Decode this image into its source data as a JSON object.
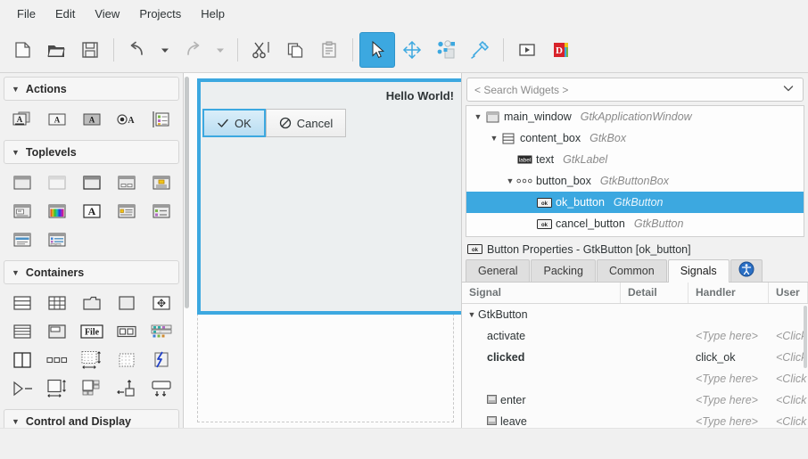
{
  "menubar": {
    "items": [
      {
        "label": "File"
      },
      {
        "label": "Edit"
      },
      {
        "label": "View"
      },
      {
        "label": "Projects"
      },
      {
        "label": "Help"
      }
    ]
  },
  "toolbar": {
    "buttons": [
      {
        "name": "new-icon",
        "label": "New"
      },
      {
        "name": "open-icon",
        "label": "Open"
      },
      {
        "name": "save-icon",
        "label": "Save"
      },
      {
        "name": "undo-icon",
        "label": "Undo"
      },
      {
        "name": "undo-dropdown-icon",
        "label": "Undo history"
      },
      {
        "name": "redo-icon",
        "label": "Redo"
      },
      {
        "name": "redo-dropdown-icon",
        "label": "Redo history"
      },
      {
        "name": "cut-icon",
        "label": "Cut"
      },
      {
        "name": "copy-icon",
        "label": "Copy"
      },
      {
        "name": "paste-icon",
        "label": "Paste"
      },
      {
        "name": "pointer-mode-icon",
        "label": "Select"
      },
      {
        "name": "drag-resize-mode-icon",
        "label": "Drag and Resize"
      },
      {
        "name": "margin-edit-mode-icon",
        "label": "Edit margins"
      },
      {
        "name": "align-edit-mode-icon",
        "label": "Edit alignment"
      },
      {
        "name": "preview-icon",
        "label": "Preview"
      },
      {
        "name": "glade-docs-icon",
        "label": "Glade"
      }
    ]
  },
  "palette": {
    "groups": [
      {
        "title": "Actions",
        "expanded": true,
        "items": [
          {
            "name": "gtk-action-icon",
            "label": "Action"
          },
          {
            "name": "gtk-toggle-action-icon",
            "label": "Toggle Action"
          },
          {
            "name": "gtk-recent-action-icon",
            "label": "Recent Action"
          },
          {
            "name": "gtk-radio-action-icon",
            "label": "Radio Action"
          },
          {
            "name": "gtk-action-group-icon",
            "label": "Action Group"
          }
        ]
      },
      {
        "title": "Toplevels",
        "expanded": true,
        "items": [
          {
            "name": "gtk-window-icon",
            "label": "Window"
          },
          {
            "name": "gtk-offscreen-window-icon",
            "label": "Offscreen Window"
          },
          {
            "name": "gtk-application-window-icon",
            "label": "Application Window"
          },
          {
            "name": "gtk-dialog-icon",
            "label": "Dialog"
          },
          {
            "name": "gtk-message-dialog-icon",
            "label": "Message Dialog"
          },
          {
            "name": "gtk-about-dialog-icon",
            "label": "About Dialog"
          },
          {
            "name": "gtk-color-chooser-dialog-icon",
            "label": "Color Chooser Dialog"
          },
          {
            "name": "gtk-font-chooser-dialog-icon",
            "label": "Font Chooser Dialog"
          },
          {
            "name": "gtk-file-chooser-dialog-icon",
            "label": "File Chooser Dialog"
          },
          {
            "name": "gtk-app-chooser-dialog-icon",
            "label": "Application Chooser Dialog"
          },
          {
            "name": "gtk-assistant-icon",
            "label": "Assistant"
          },
          {
            "name": "gtk-recent-chooser-dialog-icon",
            "label": "Recent Chooser Dialog"
          }
        ]
      },
      {
        "title": "Containers",
        "expanded": true,
        "items": [
          {
            "name": "gtk-box-icon",
            "label": "Box"
          },
          {
            "name": "gtk-grid-icon",
            "label": "Grid"
          },
          {
            "name": "gtk-notebook-icon",
            "label": "Notebook"
          },
          {
            "name": "gtk-frame-icon",
            "label": "Frame"
          },
          {
            "name": "gtk-scrolled-window-icon",
            "label": "Scrolled Window"
          },
          {
            "name": "gtk-list-box-icon",
            "label": "List Box"
          },
          {
            "name": "gtk-expander-icon",
            "label": "Expander"
          },
          {
            "name": "gtk-file-chooser-widget-icon",
            "label": "File Chooser Widget"
          },
          {
            "name": "gtk-stack-icon",
            "label": "Stack"
          },
          {
            "name": "gtk-headerbar-icon",
            "label": "Header Bar"
          },
          {
            "name": "gtk-paned-icon",
            "label": "Paned"
          },
          {
            "name": "gtk-button-box-icon",
            "label": "Button Box"
          },
          {
            "name": "gtk-fixed-icon",
            "label": "Fixed"
          },
          {
            "name": "gtk-layout-icon",
            "label": "Layout"
          },
          {
            "name": "gtk-event-box-icon",
            "label": "Event Box"
          },
          {
            "name": "gtk-overlay-icon",
            "label": "Overlay"
          },
          {
            "name": "gtk-aspect-frame-icon",
            "label": "Aspect Frame"
          },
          {
            "name": "gtk-flow-box-icon",
            "label": "Flow Box"
          },
          {
            "name": "gtk-revealer-icon",
            "label": "Revealer"
          },
          {
            "name": "gtk-popover-icon",
            "label": "Popover"
          }
        ]
      },
      {
        "title": "Control and Display",
        "expanded": true,
        "items": []
      }
    ]
  },
  "canvas": {
    "window_label": "Hello World!",
    "buttons": [
      {
        "name": "ok",
        "label": "OK",
        "icon": "check-icon",
        "selected": true
      },
      {
        "name": "cancel",
        "label": "Cancel",
        "icon": "forbidden-icon",
        "selected": false
      }
    ]
  },
  "search": {
    "placeholder": "< Search Widgets >",
    "value": ""
  },
  "widget_tree": {
    "rows": [
      {
        "indent": 0,
        "expander": "down",
        "icon": "gtk-window-icon",
        "name": "main_window",
        "type": "GtkApplicationWindow",
        "selected": false
      },
      {
        "indent": 1,
        "expander": "down",
        "icon": "gtk-box-icon",
        "name": "content_box",
        "type": "GtkBox",
        "selected": false
      },
      {
        "indent": 2,
        "expander": "none",
        "icon": "gtk-label-icon",
        "name": "text",
        "type": "GtkLabel",
        "selected": false
      },
      {
        "indent": 2,
        "expander": "down",
        "icon": "gtk-button-box-icon",
        "name": "button_box",
        "type": "GtkButtonBox",
        "selected": false
      },
      {
        "indent": 3,
        "expander": "none",
        "icon": "gtk-button-icon",
        "name": "ok_button",
        "type": "GtkButton",
        "selected": true
      },
      {
        "indent": 3,
        "expander": "none",
        "icon": "gtk-button-icon",
        "name": "cancel_button",
        "type": "GtkButton",
        "selected": false
      }
    ]
  },
  "properties": {
    "title": "Button Properties - GtkButton [ok_button]",
    "title_icon": "gtk-button-icon",
    "tabs": [
      {
        "label": "General",
        "active": false
      },
      {
        "label": "Packing",
        "active": false
      },
      {
        "label": "Common",
        "active": false
      },
      {
        "label": "Signals",
        "active": true
      },
      {
        "label": "",
        "active": false,
        "icon": "accessibility-icon"
      }
    ]
  },
  "signals": {
    "columns": [
      "Signal",
      "Detail",
      "Handler",
      "User"
    ],
    "rows": [
      {
        "kind": "group",
        "signal": "GtkButton",
        "detail": "",
        "handler": "",
        "user": "",
        "bold": false,
        "icon": "none"
      },
      {
        "kind": "signal",
        "signal": "activate",
        "detail": "",
        "handler": "<Type here>",
        "handler_placeholder": true,
        "user": "<Click",
        "user_placeholder": true,
        "bold": false,
        "icon": "none"
      },
      {
        "kind": "signal",
        "signal": "clicked",
        "detail": "",
        "handler": "click_ok",
        "handler_placeholder": false,
        "user": "<Click",
        "user_placeholder": true,
        "bold": true,
        "icon": "none"
      },
      {
        "kind": "signal",
        "signal": "",
        "detail": "",
        "handler": "<Type here>",
        "handler_placeholder": true,
        "user": "<Click",
        "user_placeholder": true,
        "bold": false,
        "icon": "none"
      },
      {
        "kind": "signal",
        "signal": "enter",
        "detail": "",
        "handler": "<Type here>",
        "handler_placeholder": true,
        "user": "<Click",
        "user_placeholder": true,
        "bold": false,
        "icon": "signal-icon"
      },
      {
        "kind": "signal",
        "signal": "leave",
        "detail": "",
        "handler": "<Type here>",
        "handler_placeholder": true,
        "user": "<Click",
        "user_placeholder": true,
        "bold": false,
        "icon": "signal-icon"
      }
    ]
  },
  "colors": {
    "accent": "#3ca8e0",
    "selection": "#3ca8e0",
    "panel_bg": "#f1f1f1",
    "canvas_bg": "#fcfcfc",
    "text": "#2e3436",
    "muted": "#8a8a8a"
  }
}
